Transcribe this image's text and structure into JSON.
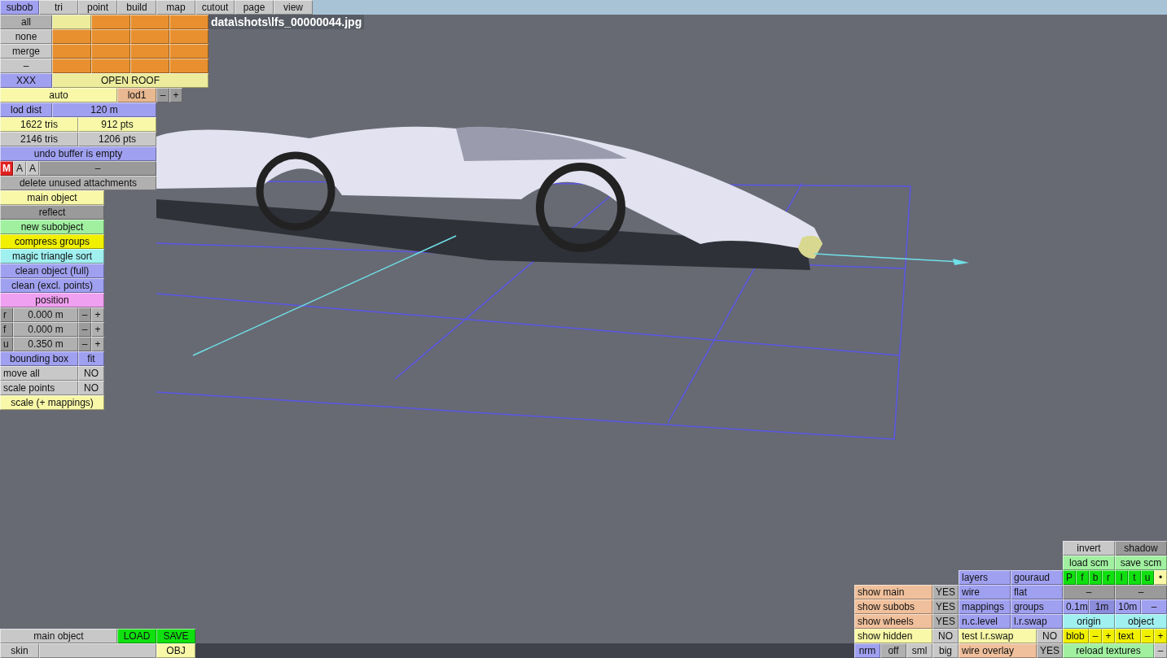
{
  "tabs": [
    {
      "label": "subob",
      "selected": true
    },
    {
      "label": "tri",
      "selected": false
    },
    {
      "label": "point",
      "selected": false
    },
    {
      "label": "build",
      "selected": false
    },
    {
      "label": "map",
      "selected": false
    },
    {
      "label": "cutout",
      "selected": false
    },
    {
      "label": "page",
      "selected": false
    },
    {
      "label": "view",
      "selected": false
    }
  ],
  "file_label": "data\\shots\\lfs_00000044.jpg",
  "left_panel": [
    [
      {
        "label": "all",
        "color": "#b0b0b0"
      },
      {
        "color": "#ecec9c"
      },
      {
        "color": "#e8902f"
      },
      {
        "color": "#e8902f"
      },
      {
        "color": "#e8902f"
      }
    ],
    [
      {
        "label": "none",
        "color": "#c8c8c8"
      },
      {
        "color": "#e8902f"
      },
      {
        "color": "#e8902f"
      },
      {
        "color": "#e8902f"
      },
      {
        "color": "#e8902f"
      }
    ],
    [
      {
        "label": "merge",
        "color": "#c8c8c8"
      },
      {
        "color": "#e8902f"
      },
      {
        "color": "#e8902f"
      },
      {
        "color": "#e8902f"
      },
      {
        "color": "#e8902f"
      }
    ],
    [
      {
        "label": "–",
        "color": "#c8c8c8"
      },
      {
        "color": "#e8902f"
      },
      {
        "color": "#e8902f"
      },
      {
        "color": "#e8902f"
      },
      {
        "color": "#e8902f"
      }
    ],
    [
      {
        "label": "XXX",
        "color": "#a0a0f0"
      },
      {
        "label": "OPEN ROOF",
        "color": "#ecec9c"
      }
    ],
    [
      {
        "label": "auto",
        "color": "#f8f8a8"
      },
      {
        "label": "lod1",
        "color": "#e8b890"
      },
      {
        "label": "–",
        "color": "#9a9a9a"
      },
      {
        "label": "+",
        "color": "#9a9a9a"
      }
    ],
    [
      {
        "label": "lod dist",
        "color": "#a0a0f0"
      },
      {
        "label": "120 m",
        "color": "#a0a0f0"
      }
    ],
    [
      {
        "label": "1622 tris",
        "color": "#f8f8a8"
      },
      {
        "label": "912 pts",
        "color": "#f8f8a8"
      }
    ],
    [
      {
        "label": "2146 tris",
        "color": "#c8c8c8"
      },
      {
        "label": "1206 pts",
        "color": "#c8c8c8"
      }
    ],
    [
      {
        "label": "undo buffer is empty",
        "color": "#a0a0f0"
      }
    ],
    [
      {
        "label": "M",
        "color": "#e02020"
      },
      {
        "label": "A",
        "color": "#c8c8c8"
      },
      {
        "label": "A",
        "color": "#c8c8c8"
      },
      {
        "label": "–",
        "color": "#9a9a9a"
      }
    ],
    [
      {
        "label": "delete unused attachments",
        "color": "#b0b0b0"
      }
    ],
    [
      {
        "label": "main object",
        "color": "#f8f8a8"
      }
    ],
    [
      {
        "label": "reflect",
        "color": "#9a9a9a"
      }
    ],
    [
      {
        "label": "new subobject",
        "color": "#a0f0a0"
      }
    ],
    [
      {
        "label": "compress groups",
        "color": "#f0f000"
      }
    ],
    [
      {
        "label": "magic triangle sort",
        "color": "#a0f0f0"
      }
    ],
    [
      {
        "label": "clean object (full)",
        "color": "#a0a0f0"
      }
    ],
    [
      {
        "label": "clean (excl. points)",
        "color": "#a0a0f0"
      }
    ],
    [
      {
        "label": "position",
        "color": "#f0a0f0"
      }
    ],
    [
      {
        "label": "r",
        "color": "#9a9a9a"
      },
      {
        "label": "0.000 m",
        "color": "#b0b0b0"
      },
      {
        "label": "–",
        "color": "#9a9a9a"
      },
      {
        "label": "+",
        "color": "#b0b0b0"
      }
    ],
    [
      {
        "label": "f",
        "color": "#9a9a9a"
      },
      {
        "label": "0.000 m",
        "color": "#b0b0b0"
      },
      {
        "label": "–",
        "color": "#9a9a9a"
      },
      {
        "label": "+",
        "color": "#b0b0b0"
      }
    ],
    [
      {
        "label": "u",
        "color": "#9a9a9a"
      },
      {
        "label": "0.350 m",
        "color": "#b0b0b0"
      },
      {
        "label": "–",
        "color": "#9a9a9a"
      },
      {
        "label": "+",
        "color": "#b0b0b0"
      }
    ],
    [
      {
        "label": "bounding box",
        "color": "#a0a0f0"
      },
      {
        "label": "fit",
        "color": "#a0a0f0"
      }
    ],
    [
      {
        "label": "move all",
        "color": "#c8c8c8"
      },
      {
        "label": "NO",
        "color": "#c8c8c8"
      }
    ],
    [
      {
        "label": "scale points",
        "color": "#c8c8c8"
      },
      {
        "label": "NO",
        "color": "#c8c8c8"
      }
    ],
    [
      {
        "label": "scale (+ mappings)",
        "color": "#f8f8a8"
      }
    ]
  ],
  "bottom_left_panel": [
    [
      {
        "label": "main object",
        "color": "#c8c8c8"
      },
      {
        "label": "LOAD",
        "color": "#10e010"
      },
      {
        "label": "SAVE",
        "color": "#10e010"
      }
    ],
    [
      {
        "label": "skin",
        "color": "#c8c8c8"
      },
      {
        "color": "#c8c8c8"
      },
      {
        "label": "OBJ",
        "color": "#f8f8a8"
      }
    ]
  ],
  "bottom_right_panel": [
    [
      {
        "label": "invert",
        "color": "#c8c8c8"
      },
      {
        "label": "shadow",
        "color": "#9a9a9a"
      }
    ],
    [
      {
        "label": "load scm",
        "color": "#a0f0a0"
      },
      {
        "label": "save scm",
        "color": "#a0f0a0"
      }
    ],
    [
      {
        "label": "layers",
        "color": "#a0a0f0"
      },
      {
        "label": "gouraud",
        "color": "#a0a0f0"
      },
      {
        "label": "P",
        "color": "#10e010"
      },
      {
        "label": "f",
        "color": "#10e010"
      },
      {
        "label": "b",
        "color": "#10e010"
      },
      {
        "label": "r",
        "color": "#10e010"
      },
      {
        "label": "l",
        "color": "#10e010"
      },
      {
        "label": "t",
        "color": "#10e010"
      },
      {
        "label": "u",
        "color": "#10e010"
      },
      {
        "label": "•",
        "color": "#f8f8a8"
      }
    ],
    [
      {
        "label": "show main",
        "color": "#f0c09c"
      },
      {
        "label": "YES",
        "color": "#b0b0b0"
      },
      {
        "label": "wire",
        "color": "#a0a0f0"
      },
      {
        "label": "flat",
        "color": "#a0a0f0"
      },
      {
        "label": "–",
        "color": "#9a9a9a"
      },
      {
        "label": "–",
        "color": "#9a9a9a"
      }
    ],
    [
      {
        "label": "show subobs",
        "color": "#f0c09c"
      },
      {
        "label": "YES",
        "color": "#b0b0b0"
      },
      {
        "label": "mappings",
        "color": "#a0a0f0"
      },
      {
        "label": "groups",
        "color": "#a0a0f0"
      },
      {
        "label": "0.1m",
        "color": "#a0a0f0"
      },
      {
        "label": "1m",
        "color": "#8c8cdc"
      },
      {
        "label": "10m",
        "color": "#a0a0f0"
      },
      {
        "label": "–",
        "color": "#a0a0f0"
      }
    ],
    [
      {
        "label": "show wheels",
        "color": "#f0c09c"
      },
      {
        "label": "YES",
        "color": "#b0b0b0"
      },
      {
        "label": "n.c.level",
        "color": "#a0a0f0"
      },
      {
        "label": "l.r.swap",
        "color": "#a0a0f0"
      },
      {
        "label": "origin",
        "color": "#a0f0f0"
      },
      {
        "label": "object",
        "color": "#a0f0f0"
      }
    ],
    [
      {
        "label": "show hidden",
        "color": "#f8f8a8"
      },
      {
        "label": "NO",
        "color": "#c8c8c8"
      },
      {
        "label": "test l.r.swap",
        "color": "#f8f8a8"
      },
      {
        "label": "NO",
        "color": "#c8c8c8"
      },
      {
        "label": "blob",
        "color": "#f0f000"
      },
      {
        "label": "–",
        "color": "#f0f000"
      },
      {
        "label": "+",
        "color": "#f0f000"
      },
      {
        "label": "text",
        "color": "#f0f000"
      },
      {
        "label": "–",
        "color": "#f0f000"
      },
      {
        "label": "+",
        "color": "#f0f000"
      }
    ],
    [
      {
        "label": "nrm",
        "color": "#a0a0f0"
      },
      {
        "label": "off",
        "color": "#b0b0b0"
      },
      {
        "label": "sml",
        "color": "#c8c8c8"
      },
      {
        "label": "big",
        "color": "#c8c8c8"
      },
      {
        "label": "wire overlay",
        "color": "#f0c09c"
      },
      {
        "label": "YES",
        "color": "#b0b0b0"
      },
      {
        "label": "reload textures",
        "color": "#a0f0a0"
      },
      {
        "label": "–",
        "color": "#c8c8c8"
      }
    ]
  ]
}
